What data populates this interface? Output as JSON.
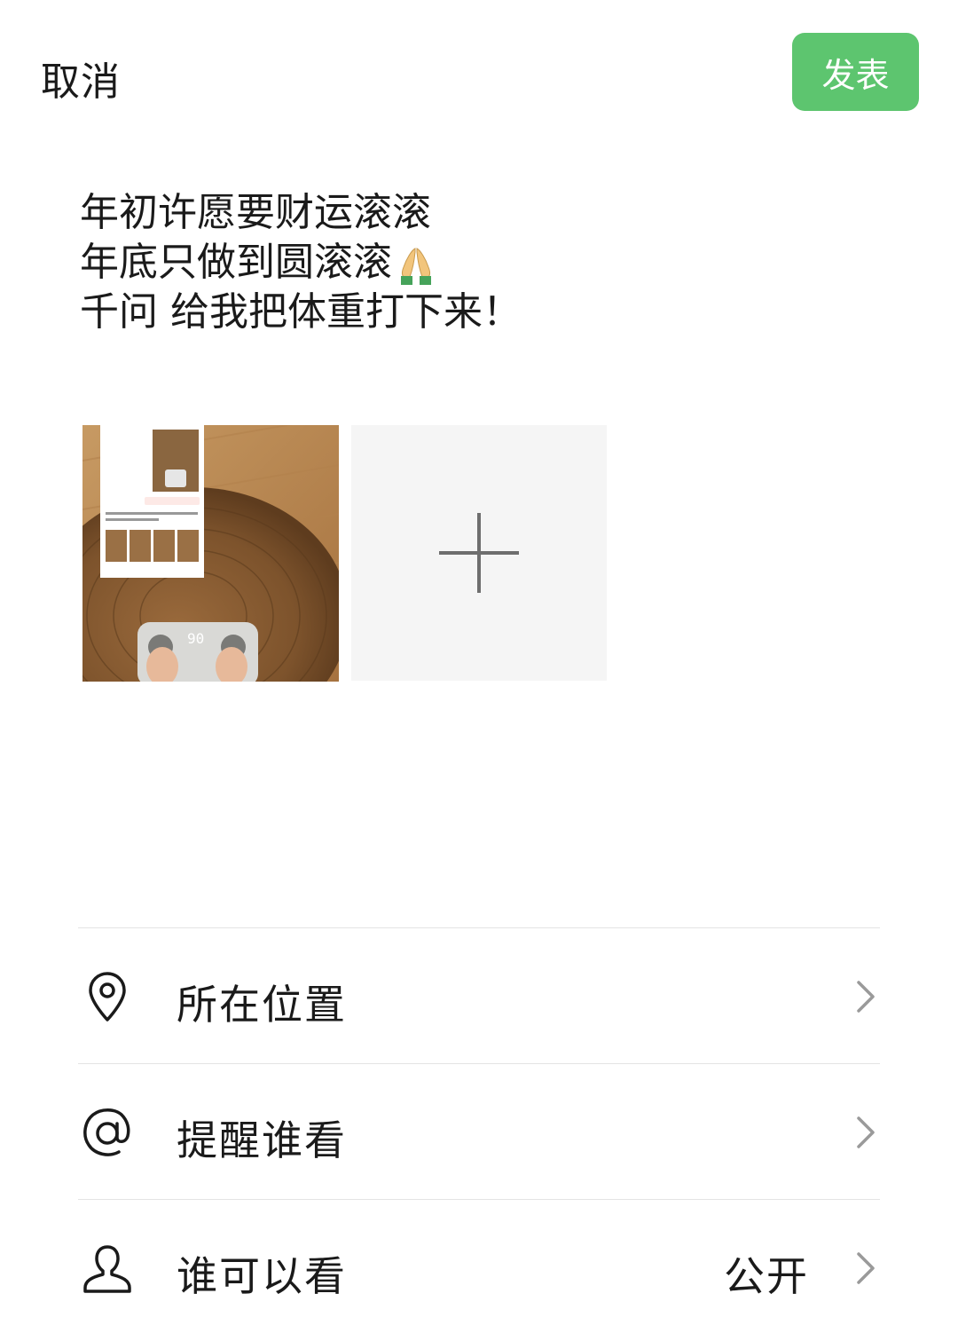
{
  "header": {
    "cancel_label": "取消",
    "publish_label": "发表",
    "publish_color": "#5dc56f"
  },
  "post": {
    "lines": [
      "年初许愿要财运滚滚",
      "年底只做到圆滚滚",
      "千问 给我把体重打下来！"
    ],
    "line2_emoji": "folded-hands-emoji"
  },
  "photos": {
    "thumb_scale_reading": "90",
    "add_icon": "plus-icon"
  },
  "options": [
    {
      "icon": "location-pin-icon",
      "label": "所在位置",
      "value": ""
    },
    {
      "icon": "at-sign-icon",
      "label": "提醒谁看",
      "value": ""
    },
    {
      "icon": "person-icon",
      "label": "谁可以看",
      "value": "公开"
    }
  ]
}
